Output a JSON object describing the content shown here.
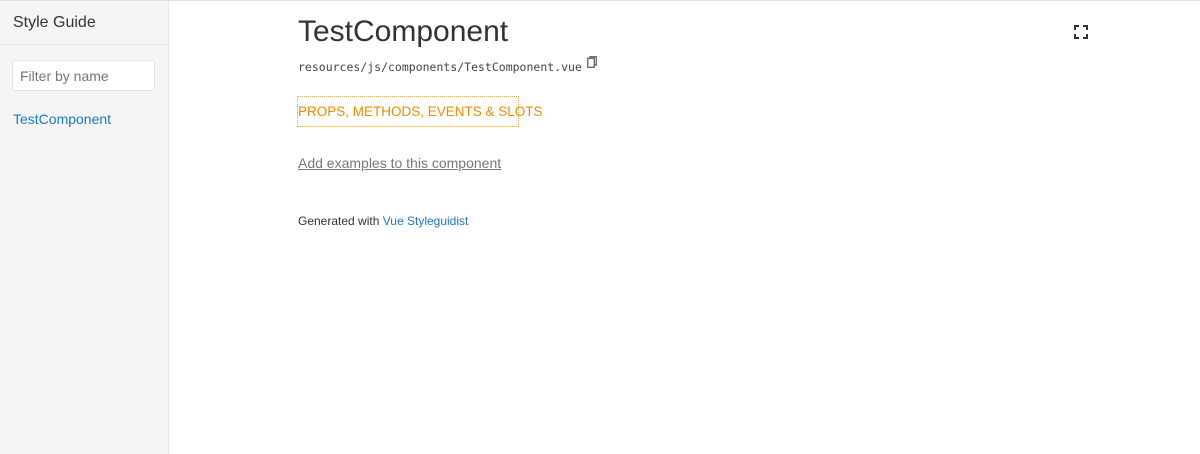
{
  "sidebar": {
    "title": "Style Guide",
    "filter_placeholder": "Filter by name",
    "items": [
      {
        "label": "TestComponent"
      }
    ]
  },
  "main": {
    "component_name": "TestComponent",
    "file_path": "resources/js/components/TestComponent.vue",
    "copy_icon": "copy-icon",
    "fullscreen_icon": "fullscreen-icon",
    "tab_label": "PROPS, METHODS, EVENTS & SLOTS",
    "add_examples_label": "Add examples to this component"
  },
  "footer": {
    "prefix": "Generated with",
    "link_label": "Vue Styleguidist"
  },
  "colors": {
    "link": "#1978c8",
    "tab_accent": "#f28a00",
    "sidebar_bg": "#f5f5f5"
  }
}
